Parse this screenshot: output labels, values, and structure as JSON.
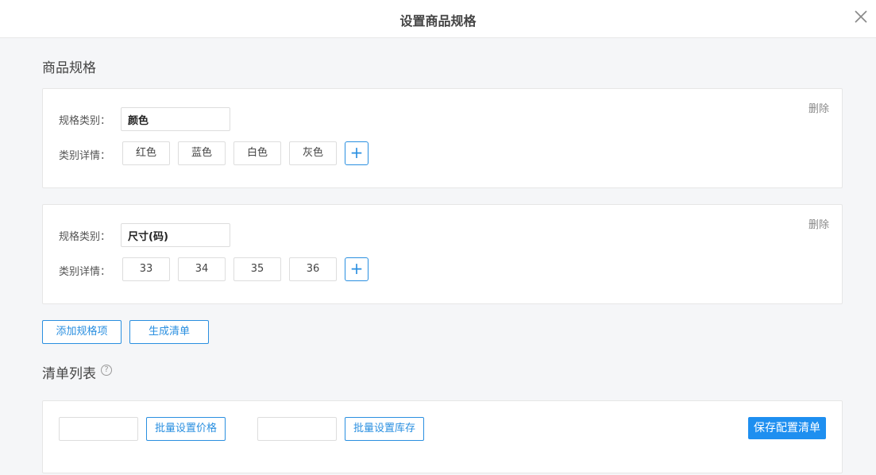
{
  "dialog": {
    "title": "设置商品规格"
  },
  "spec_section": {
    "title": "商品规格"
  },
  "spec_groups": [
    {
      "delete_label": "删除",
      "type_label": "规格类别：",
      "type_value": "颜色",
      "detail_label": "类别详情：",
      "details": [
        "红色",
        "蓝色",
        "白色",
        "灰色"
      ],
      "add_symbol": "+"
    },
    {
      "delete_label": "删除",
      "type_label": "规格类别：",
      "type_value": "尺寸(码)",
      "detail_label": "类别详情：",
      "details": [
        "33",
        "34",
        "35",
        "36"
      ],
      "add_symbol": "+"
    }
  ],
  "actions": {
    "add_spec_label": "添加规格项",
    "generate_label": "生成清单"
  },
  "list_section": {
    "title": "清单列表",
    "help_symbol": "?"
  },
  "batch": {
    "price_value": "",
    "set_price_label": "批量设置价格",
    "stock_value": "",
    "set_stock_label": "批量设置库存",
    "save_label": "保存配置清单"
  },
  "colors": {
    "accent": "#1e8ff0",
    "border": "#e6e6e6",
    "background": "#f5f6f8"
  },
  "icons": {
    "close": "close-icon",
    "plus": "plus-icon",
    "help": "help-icon"
  }
}
